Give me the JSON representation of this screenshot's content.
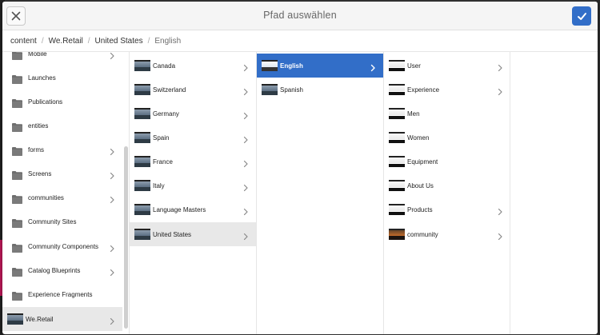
{
  "dialog": {
    "title": "Pfad auswählen"
  },
  "breadcrumb": {
    "items": [
      "content",
      "We.Retail",
      "United States",
      "English"
    ],
    "separator": "/"
  },
  "columns": [
    {
      "items": [
        {
          "label": "Mobile",
          "icon": "folder-icon",
          "chevron": true
        },
        {
          "label": "Launches",
          "icon": "folder-icon",
          "chevron": false
        },
        {
          "label": "Publications",
          "icon": "folder-icon",
          "chevron": false
        },
        {
          "label": "entities",
          "icon": "folder-icon",
          "chevron": false
        },
        {
          "label": "forms",
          "icon": "folder-icon",
          "chevron": true
        },
        {
          "label": "Screens",
          "icon": "folder-icon",
          "chevron": true
        },
        {
          "label": "communities",
          "icon": "folder-icon",
          "chevron": true
        },
        {
          "label": "Community Sites",
          "icon": "folder-icon",
          "chevron": false
        },
        {
          "label": "Community Components",
          "icon": "folder-icon",
          "chevron": true
        },
        {
          "label": "Catalog Blueprints",
          "icon": "folder-icon",
          "chevron": true
        },
        {
          "label": "Experience Fragments",
          "icon": "folder-icon",
          "chevron": false
        },
        {
          "label": "We.Retail",
          "icon": "page-thumbnail-icon",
          "chevron": true,
          "selected": true
        }
      ]
    },
    {
      "items": [
        {
          "label": "Canada",
          "icon": "page-thumbnail-icon",
          "chevron": true
        },
        {
          "label": "Switzerland",
          "icon": "page-thumbnail-icon",
          "chevron": true
        },
        {
          "label": "Germany",
          "icon": "page-thumbnail-icon",
          "chevron": true
        },
        {
          "label": "Spain",
          "icon": "page-thumbnail-icon",
          "chevron": true
        },
        {
          "label": "France",
          "icon": "page-thumbnail-icon",
          "chevron": true
        },
        {
          "label": "Italy",
          "icon": "page-thumbnail-icon",
          "chevron": true
        },
        {
          "label": "Language Masters",
          "icon": "page-thumbnail-icon",
          "chevron": true
        },
        {
          "label": "United States",
          "icon": "page-thumbnail-icon",
          "chevron": true,
          "selected": true
        }
      ]
    },
    {
      "items": [
        {
          "label": "English",
          "icon": "page-thumbnail-icon",
          "chevron": true,
          "active": true
        },
        {
          "label": "Spanish",
          "icon": "page-thumbnail-icon",
          "chevron": false
        }
      ]
    },
    {
      "items": [
        {
          "label": "User",
          "icon": "page-thumbnail-icon",
          "chevron": true
        },
        {
          "label": "Experience",
          "icon": "page-thumbnail-icon",
          "chevron": true
        },
        {
          "label": "Men",
          "icon": "page-thumbnail-icon",
          "chevron": false
        },
        {
          "label": "Women",
          "icon": "page-thumbnail-icon",
          "chevron": false
        },
        {
          "label": "Equipment",
          "icon": "page-thumbnail-icon",
          "chevron": false
        },
        {
          "label": "About Us",
          "icon": "page-thumbnail-icon",
          "chevron": false
        },
        {
          "label": "Products",
          "icon": "page-thumbnail-icon",
          "chevron": true
        },
        {
          "label": "community",
          "icon": "page-thumbnail-icon",
          "chevron": true
        }
      ]
    }
  ],
  "colors": {
    "accent": "#326ec8",
    "selected_grey": "#e8e8e8"
  }
}
